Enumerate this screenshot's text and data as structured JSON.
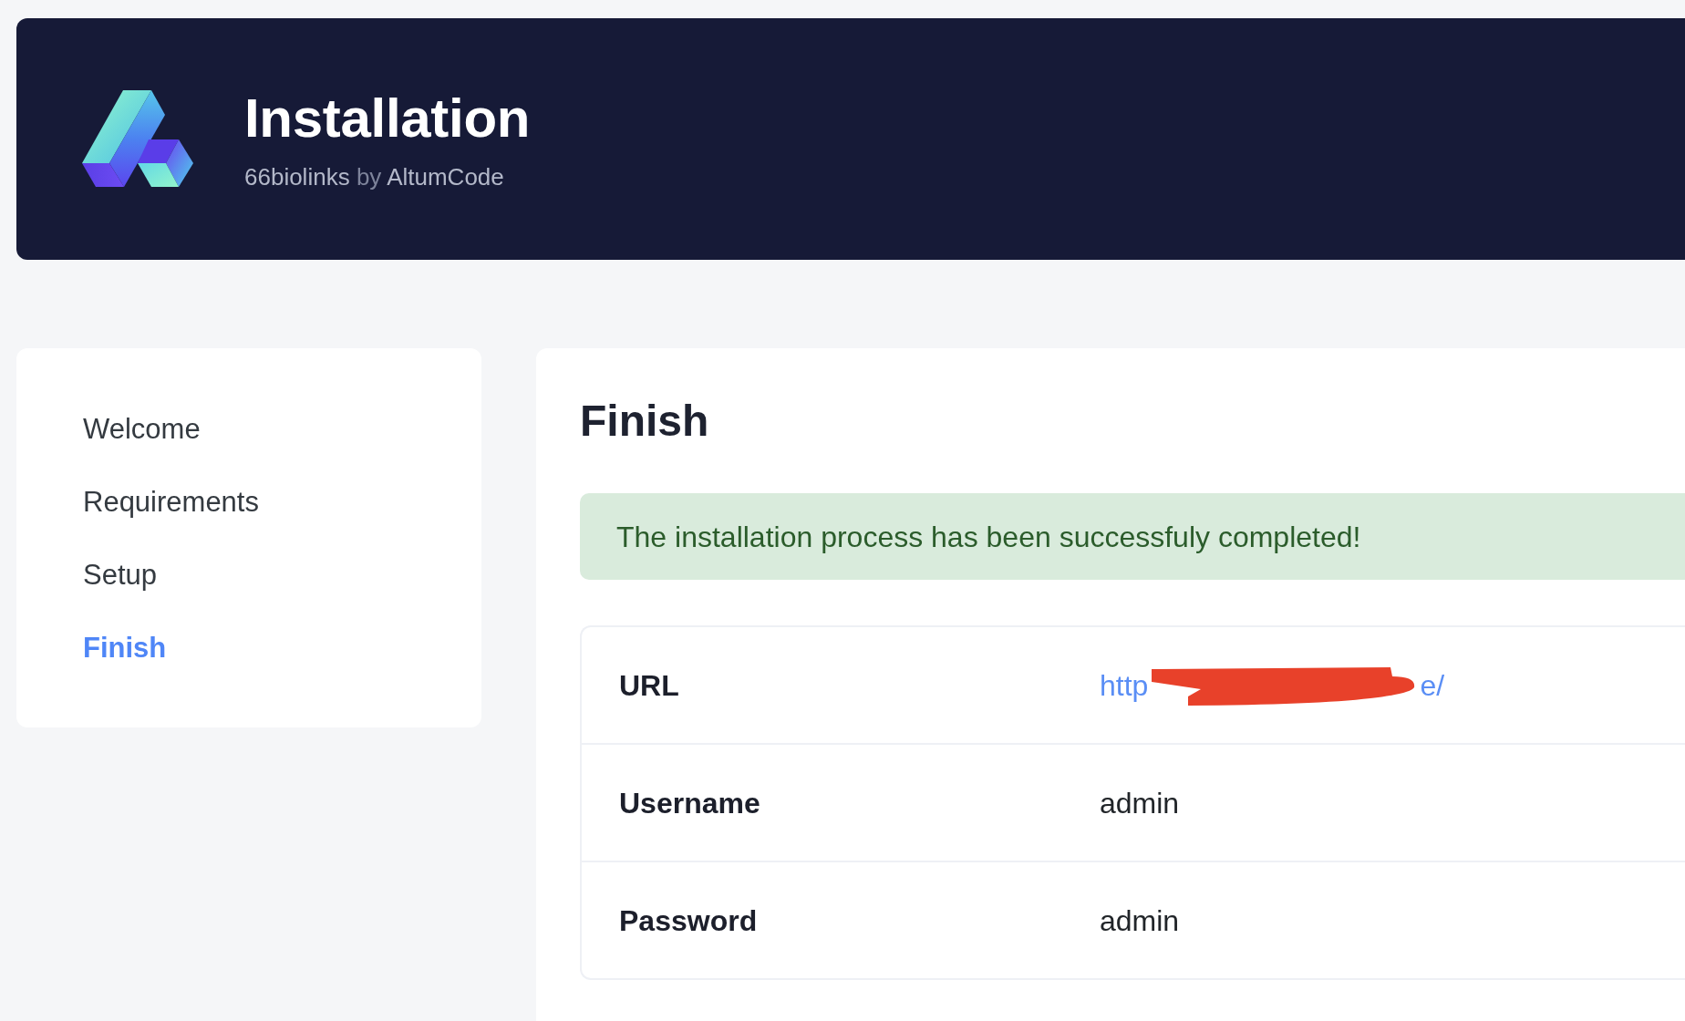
{
  "header": {
    "title": "Installation",
    "product": "66biolinks",
    "joiner": "by",
    "author": "AltumCode"
  },
  "sidebar": {
    "items": [
      {
        "label": "Welcome",
        "selected": false
      },
      {
        "label": "Requirements",
        "selected": false
      },
      {
        "label": "Setup",
        "selected": false
      },
      {
        "label": "Finish",
        "selected": true
      }
    ]
  },
  "content": {
    "heading": "Finish",
    "alert": {
      "kind": "success",
      "message": "The installation process has been successfuly completed!"
    },
    "details": [
      {
        "label": "URL",
        "kind": "redacted-link",
        "parts": [
          "http",
          "e/"
        ]
      },
      {
        "label": "Username",
        "kind": "text",
        "value": "admin"
      },
      {
        "label": "Password",
        "kind": "text",
        "value": "admin"
      }
    ]
  }
}
